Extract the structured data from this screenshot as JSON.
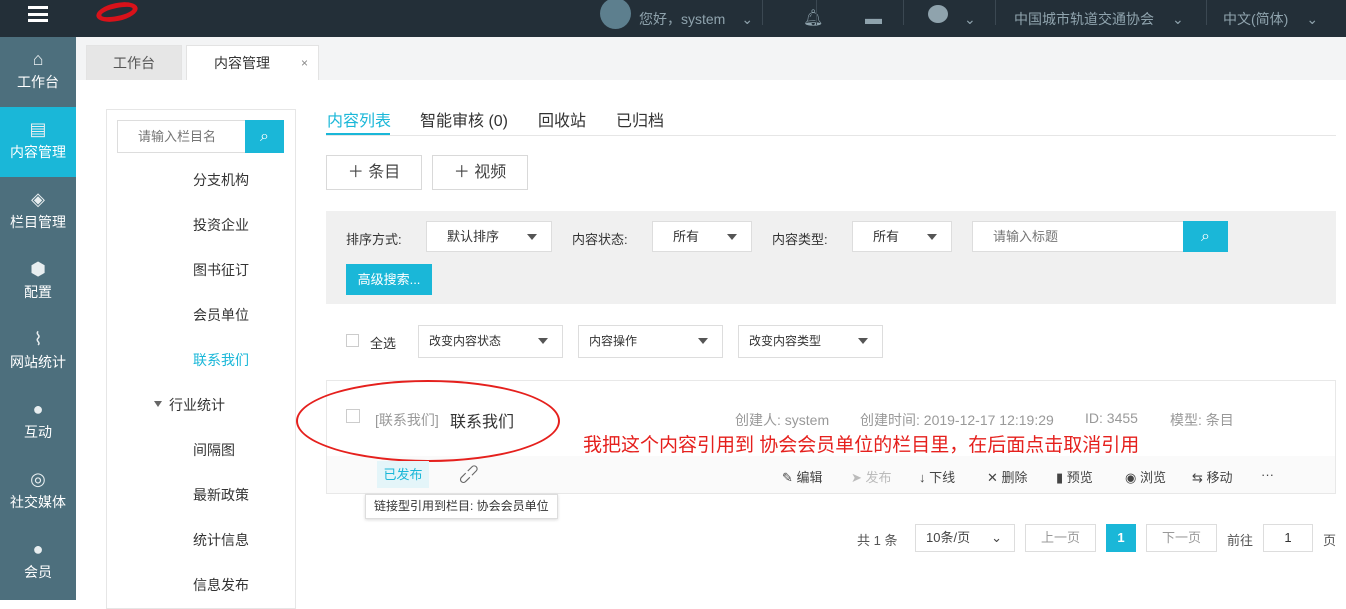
{
  "header": {
    "greeting": "您好，system",
    "org": "中国城市轨道交通协会",
    "language": "中文(简体)"
  },
  "sidebar": {
    "items": [
      {
        "label": "工作台",
        "icon": "home-icon"
      },
      {
        "label": "内容管理",
        "icon": "document-icon"
      },
      {
        "label": "栏目管理",
        "icon": "layers-icon"
      },
      {
        "label": "配置",
        "icon": "cube-icon"
      },
      {
        "label": "网站统计",
        "icon": "chart-icon"
      },
      {
        "label": "互动",
        "icon": "chat-icon"
      },
      {
        "label": "社交媒体",
        "icon": "social-icon"
      },
      {
        "label": "会员",
        "icon": "user-icon"
      }
    ]
  },
  "tabs": [
    {
      "label": "工作台"
    },
    {
      "label": "内容管理",
      "close": "×"
    }
  ],
  "tree": {
    "search_placeholder": "请输入栏目名",
    "items": [
      "分支机构",
      "投资企业",
      "图书征订",
      "会员单位",
      "联系我们",
      "行业统计",
      "间隔图",
      "最新政策",
      "统计信息",
      "信息发布"
    ]
  },
  "content_tabs": [
    "内容列表",
    "智能审核 (0)",
    "回收站",
    "已归档"
  ],
  "buttons": {
    "add_item": "条目",
    "add_video": "视频",
    "advanced": "高级搜索..."
  },
  "filters": {
    "sort_label": "排序方式:",
    "sort_value": "默认排序",
    "status_label": "内容状态:",
    "status_value": "所有",
    "type_label": "内容类型:",
    "type_value": "所有",
    "title_placeholder": "请输入标题"
  },
  "bulk": {
    "select_all": "全选",
    "change_status": "改变内容状态",
    "operations": "内容操作",
    "change_type": "改变内容类型"
  },
  "item": {
    "channel": "[联系我们]",
    "title": "联系我们",
    "creator": "创建人: system",
    "created": "创建时间: 2019-12-17 12:19:29",
    "id": "ID: 3455",
    "model": "模型: 条目",
    "status": "已发布",
    "actions": [
      "编辑",
      "发布",
      "下线",
      "删除",
      "预览",
      "浏览",
      "移动",
      "···"
    ],
    "tooltip": "链接型引用到栏目: 协会会员单位"
  },
  "annotation": "我把这个内容引用到 协会会员单位的栏目里，在后面点击取消引用",
  "pagination": {
    "total": "共 1 条",
    "page_size": "10条/页",
    "prev": "上一页",
    "current": "1",
    "next": "下一页",
    "goto": "前往",
    "goto_value": "1",
    "page_suffix": "页"
  },
  "colors": {
    "accent": "#1ab7d8",
    "topbar": "#232f38",
    "sidebar": "#4d6f7d",
    "annotation": "#e5201d"
  }
}
